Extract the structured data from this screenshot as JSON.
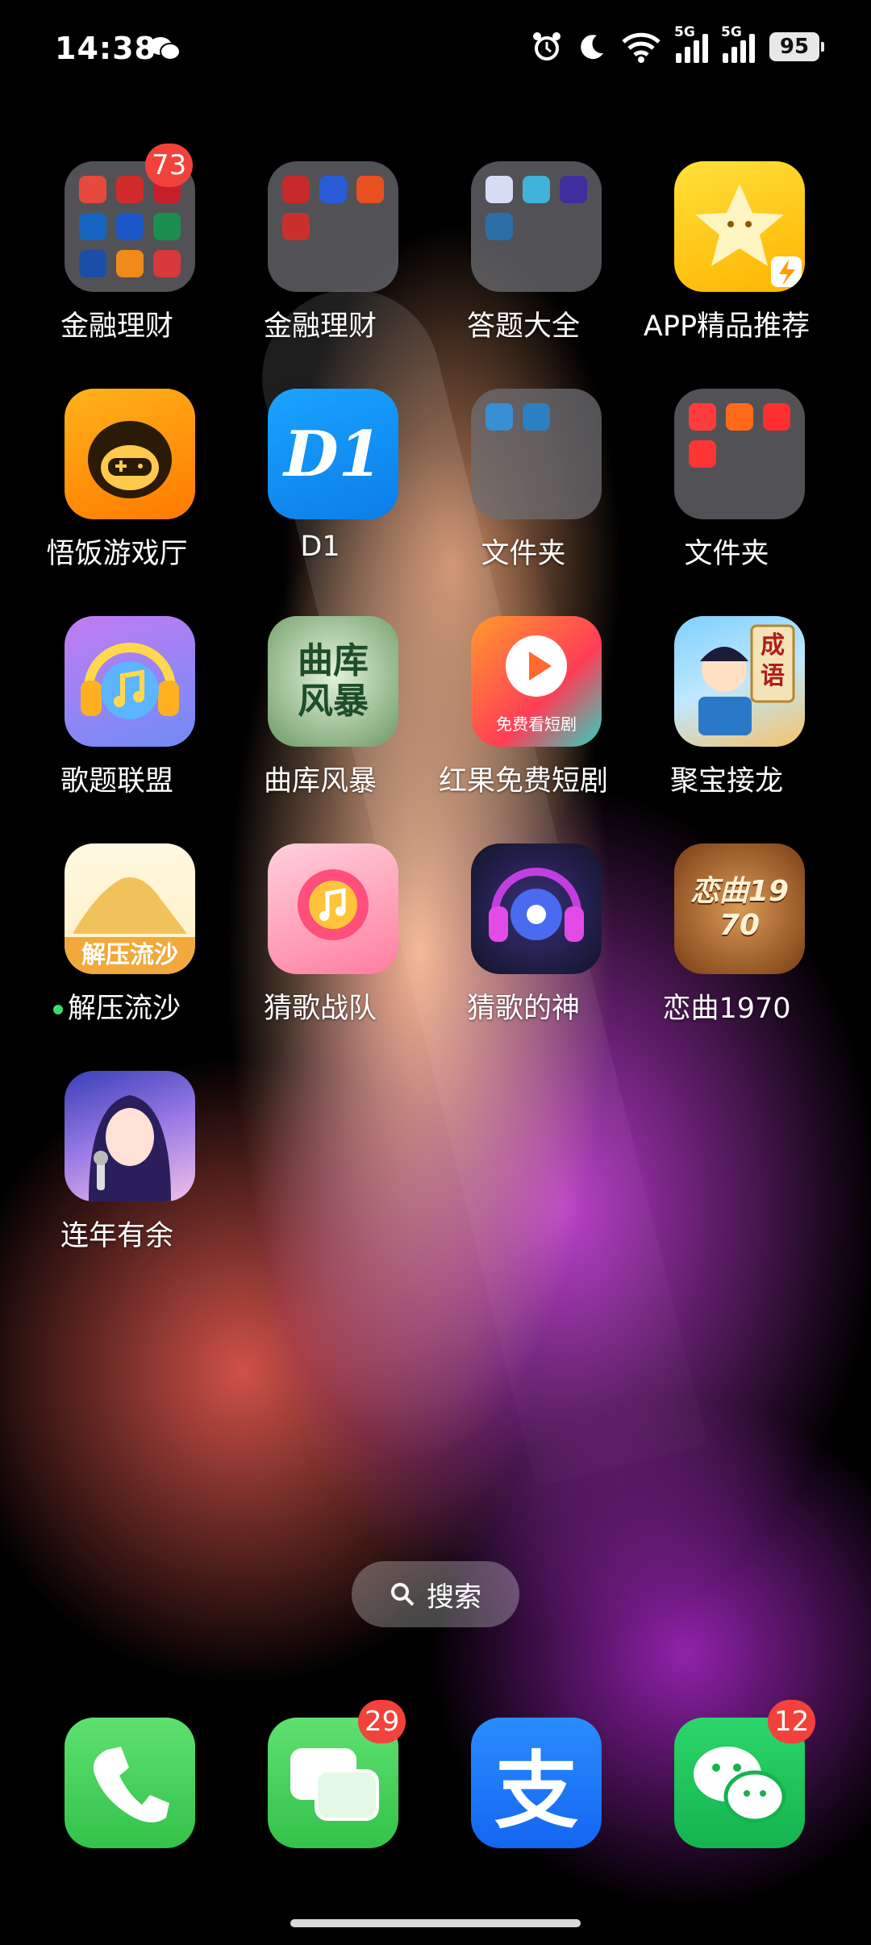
{
  "status_bar": {
    "time": "14:38",
    "network_1": "5G",
    "network_2": "5G",
    "battery": "95",
    "icons": [
      "wechat-icon",
      "alarm-icon",
      "moon-icon",
      "wifi-icon",
      "signal-icon",
      "signal-icon",
      "battery-icon"
    ]
  },
  "apps": [
    {
      "label": "金融理财",
      "type": "folder",
      "badge": "73"
    },
    {
      "label": "金融理财",
      "type": "folder"
    },
    {
      "label": "答题大全",
      "type": "folder"
    },
    {
      "label": "APP精品推荐",
      "type": "app",
      "icon": "star-icon",
      "colors": [
        "#ffd21f",
        "#ffb800"
      ]
    },
    {
      "label": "悟饭游戏厅",
      "type": "app",
      "icon": "monkey-gamepad-icon",
      "colors": [
        "#ffb21a",
        "#ff7a00"
      ]
    },
    {
      "label": "D1",
      "type": "app",
      "icon": "d1-logo",
      "colors": [
        "#1aa3ff",
        "#0b7ee8"
      ],
      "icon_text": "D1"
    },
    {
      "label": "文件夹",
      "type": "folder"
    },
    {
      "label": "文件夹",
      "type": "folder"
    },
    {
      "label": "歌题联盟",
      "type": "app",
      "icon": "music-headphones-icon",
      "colors": [
        "#c27cf2",
        "#6f8cf7"
      ]
    },
    {
      "label": "曲库风暴",
      "type": "app",
      "icon": "qu-ku-feng-bao-logo",
      "colors": [
        "#cfe8c8",
        "#5a8a5a"
      ],
      "icon_text": "曲库风暴"
    },
    {
      "label": "红果免费短剧",
      "type": "app",
      "icon": "play-icon",
      "colors": [
        "#ff7a2e",
        "#ff3d57"
      ],
      "icon_text": "免费看短剧"
    },
    {
      "label": "聚宝接龙",
      "type": "app",
      "icon": "idiom-scholar-icon",
      "colors": [
        "#7fd0ff",
        "#f4c36a"
      ],
      "icon_text": "成语"
    },
    {
      "label": "解压流沙",
      "type": "app",
      "icon": "sand-pile-icon",
      "colors": [
        "#fff6d6",
        "#f2b33a"
      ],
      "icon_text": "解压流沙",
      "new_dot": true
    },
    {
      "label": "猜歌战队",
      "type": "app",
      "icon": "flower-music-icon",
      "colors": [
        "#ffb3c6",
        "#ff5f8a"
      ]
    },
    {
      "label": "猜歌的神",
      "type": "app",
      "icon": "headphones-disc-icon",
      "colors": [
        "#2a2f5a",
        "#8d3ccf"
      ]
    },
    {
      "label": "恋曲1970",
      "type": "app",
      "icon": "cassette-icon",
      "colors": [
        "#c9823e",
        "#7a3d14"
      ],
      "icon_text": "恋曲1970"
    },
    {
      "label": "连年有余",
      "type": "app",
      "icon": "singer-girl-icon",
      "colors": [
        "#5c4fd1",
        "#e6b1e8"
      ]
    }
  ],
  "search": {
    "label": "搜索"
  },
  "dock": [
    {
      "name": "phone",
      "icon": "phone-icon",
      "color": "#4cd964"
    },
    {
      "name": "messages",
      "icon": "messages-icon",
      "color": "#4cd964",
      "badge": "29"
    },
    {
      "name": "alipay",
      "icon": "alipay-icon",
      "color": "#1677ff",
      "icon_text": "支"
    },
    {
      "name": "wechat",
      "icon": "wechat-icon",
      "color": "#1fc15a",
      "badge": "12"
    }
  ]
}
